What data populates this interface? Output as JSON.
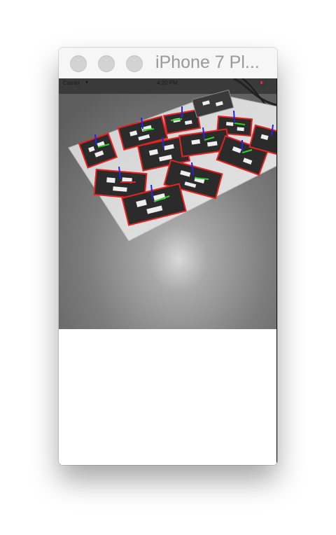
{
  "window": {
    "title": "iPhone 7 Pl..."
  },
  "status_bar": {
    "carrier": "Carrier",
    "wifi_icon": "wifi-icon",
    "time": "4:20 PM",
    "battery_icon": "battery-icon"
  },
  "camera_view": {
    "marker_outline_color": "#e52222",
    "axis_colors": {
      "x": "#2ed02e",
      "y": "#e52222",
      "z": "#2424e6"
    }
  }
}
